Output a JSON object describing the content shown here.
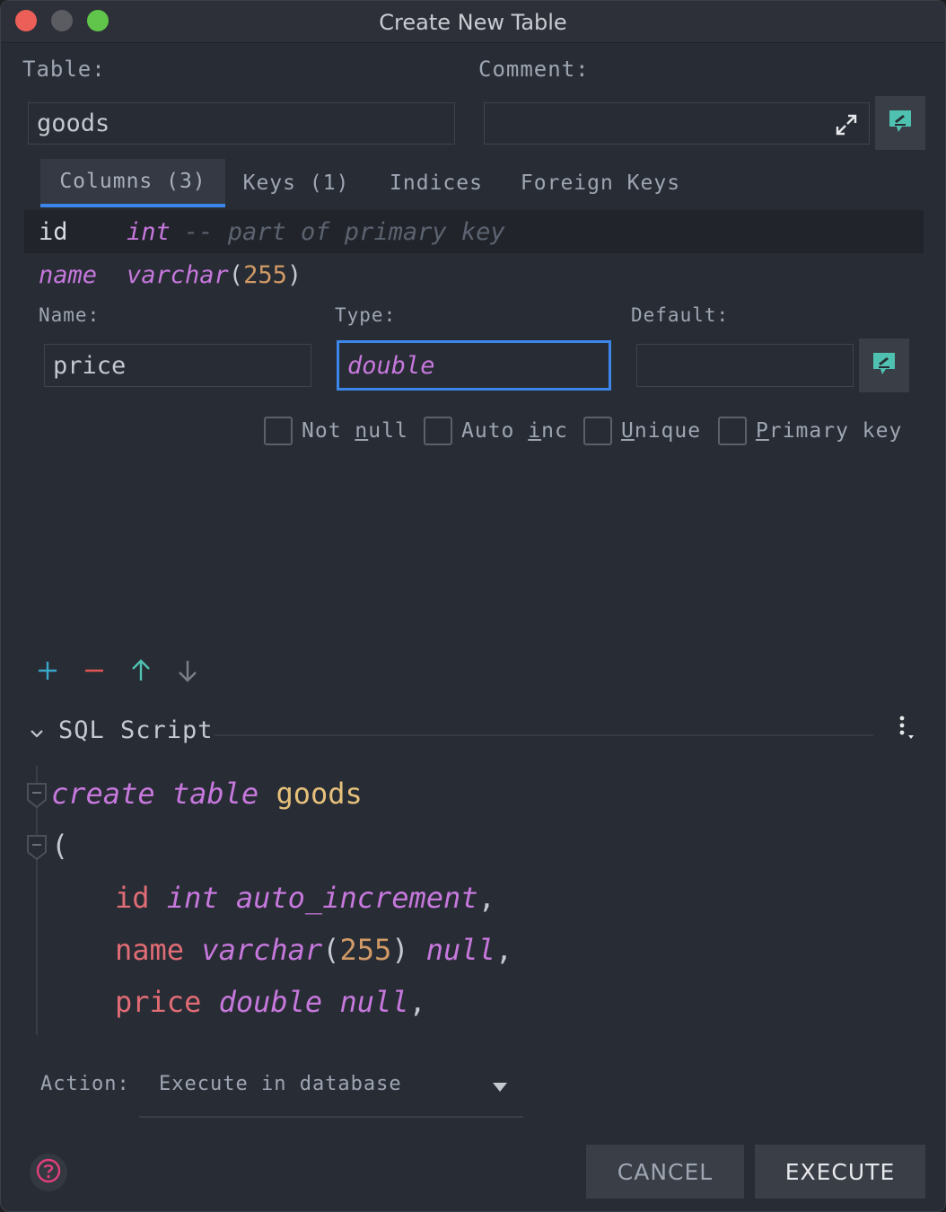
{
  "window": {
    "title": "Create New Table"
  },
  "table": {
    "label": "Table:",
    "value": "goods"
  },
  "comment": {
    "label": "Comment:",
    "value": ""
  },
  "tabs": [
    {
      "label": "Columns (3)",
      "active": true
    },
    {
      "label": "Keys (1)",
      "active": false
    },
    {
      "label": "Indices",
      "active": false
    },
    {
      "label": "Foreign Keys",
      "active": false
    }
  ],
  "columns": [
    {
      "name": "id",
      "type": "int",
      "comment": "-- part of primary key"
    },
    {
      "name": "name",
      "type": "varchar",
      "type_arg": "255"
    }
  ],
  "editor": {
    "name_label": "Name:",
    "name_value": "price",
    "type_label": "Type:",
    "type_value": "double",
    "default_label": "Default:",
    "default_value": ""
  },
  "checkboxes": [
    {
      "pre": "Not ",
      "mnemonic": "n",
      "post": "ull",
      "checked": false
    },
    {
      "pre": "Auto ",
      "mnemonic": "i",
      "post": "nc",
      "checked": false
    },
    {
      "pre": "",
      "mnemonic": "U",
      "post": "nique",
      "checked": false
    },
    {
      "pre": "",
      "mnemonic": "P",
      "post": "rimary key",
      "checked": false
    }
  ],
  "toolbar_icons": [
    "plus-icon",
    "minus-icon",
    "arrow-up-icon",
    "arrow-down-icon"
  ],
  "sql": {
    "section_label": "SQL Script",
    "kw_create": "create",
    "kw_table": "table",
    "table_name": "goods",
    "open_paren": "(",
    "l1_col": "id",
    "l1_type": "int",
    "l1_extra": "auto_increment",
    "l1_comma": ",",
    "l2_col": "name",
    "l2_type": "varchar",
    "l2_open": "(",
    "l2_num": "255",
    "l2_close": ")",
    "l2_null": "null",
    "l2_comma": ",",
    "l3_col": "price",
    "l3_type": "double",
    "l3_null": "null",
    "l3_comma": ","
  },
  "action": {
    "label": "Action:",
    "value": "Execute in database"
  },
  "buttons": {
    "cancel": "CANCEL",
    "execute": "EXECUTE"
  },
  "colors": {
    "accent": "#3b86e8",
    "teal_icon": "#4fc1b0",
    "keyword": "#c678dd",
    "column": "#e06c75",
    "number": "#d19a66",
    "identifier": "#e5c07b",
    "help": "#e0407a"
  }
}
